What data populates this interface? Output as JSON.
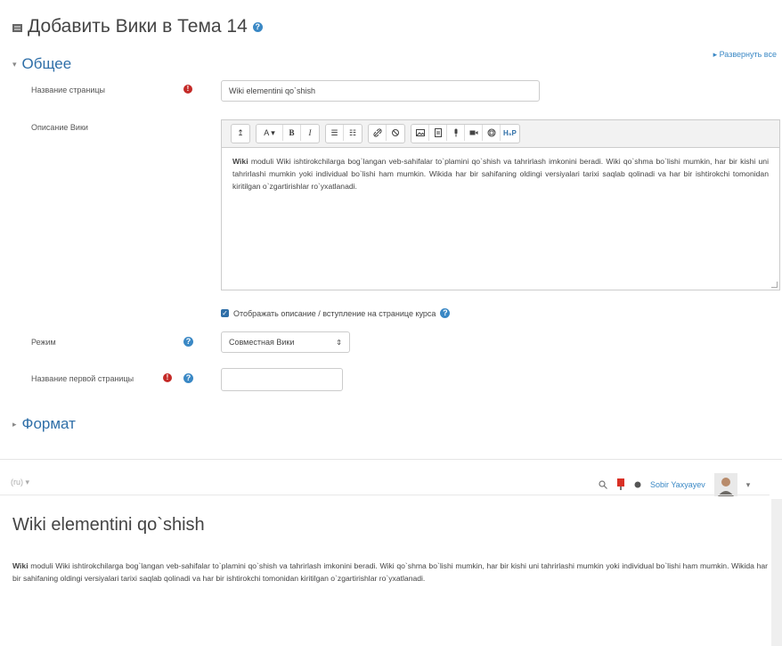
{
  "header": {
    "title": "Добавить Вики в Тема 14",
    "expand_all": "▸ Развернуть все"
  },
  "general": {
    "legend": "Общее",
    "page_name_label": "Название страницы",
    "page_name_value": "Wiki elementini qo`shish",
    "description_label": "Описание Вики",
    "description_text_bold": "Wiki",
    "description_text": " moduli Wiki ishtirokchilarga bog`langan veb-sahifalar to`plamini qo`shish va tahrirlash imkonini beradi. Wiki qo`shma bo`lishi mumkin, har bir kishi uni tahrirlashi mumkin yoki individual bo`lishi ham mumkin. Wikida har bir sahifaning oldingi versiyalari tarixi saqlab qolinadi va har bir ishtirokchi tomonidan kiritilgan o`zgartirishlar ro`yxatlanadi.",
    "show_description_label": "Отображать описание / вступление на странице курса",
    "mode_label": "Режим",
    "mode_value": "Совместная Вики",
    "first_page_label": "Название первой страницы",
    "first_page_value": ""
  },
  "toolbar": {
    "buttons": [
      "↥",
      "A ▾",
      "B",
      "I",
      "☰",
      "☷",
      "🔗",
      "⊘",
      "▣",
      "▤",
      "🎤",
      "■",
      "⌬",
      "H₅P"
    ]
  },
  "format": {
    "legend": "Формат"
  },
  "topbar": {
    "lang": "(ru) ▾",
    "user_name": "Sobir Yaxyayev",
    "menu_caret": "▾"
  },
  "content": {
    "title": "Wiki elementini qo`shish",
    "text_bold": "Wiki",
    "text": " moduli Wiki ishtirokchilarga bog`langan veb-sahifalar to`plamini qo`shish va tahrirlash imkonini beradi. Wiki qo`shma bo`lishi mumkin, har bir kishi uni tahrirlashi mumkin yoki individual bo`lishi ham mumkin. Wikida har bir sahifaning oldingi versiyalari tarixi saqlab qolinadi va har bir ishtirokchi tomonidan kiritilgan o`zgartirishlar ro`yxatlanadi."
  },
  "colors": {
    "accent": "#2f6fa8",
    "help": "#3a88c5",
    "required": "#c42a27"
  }
}
